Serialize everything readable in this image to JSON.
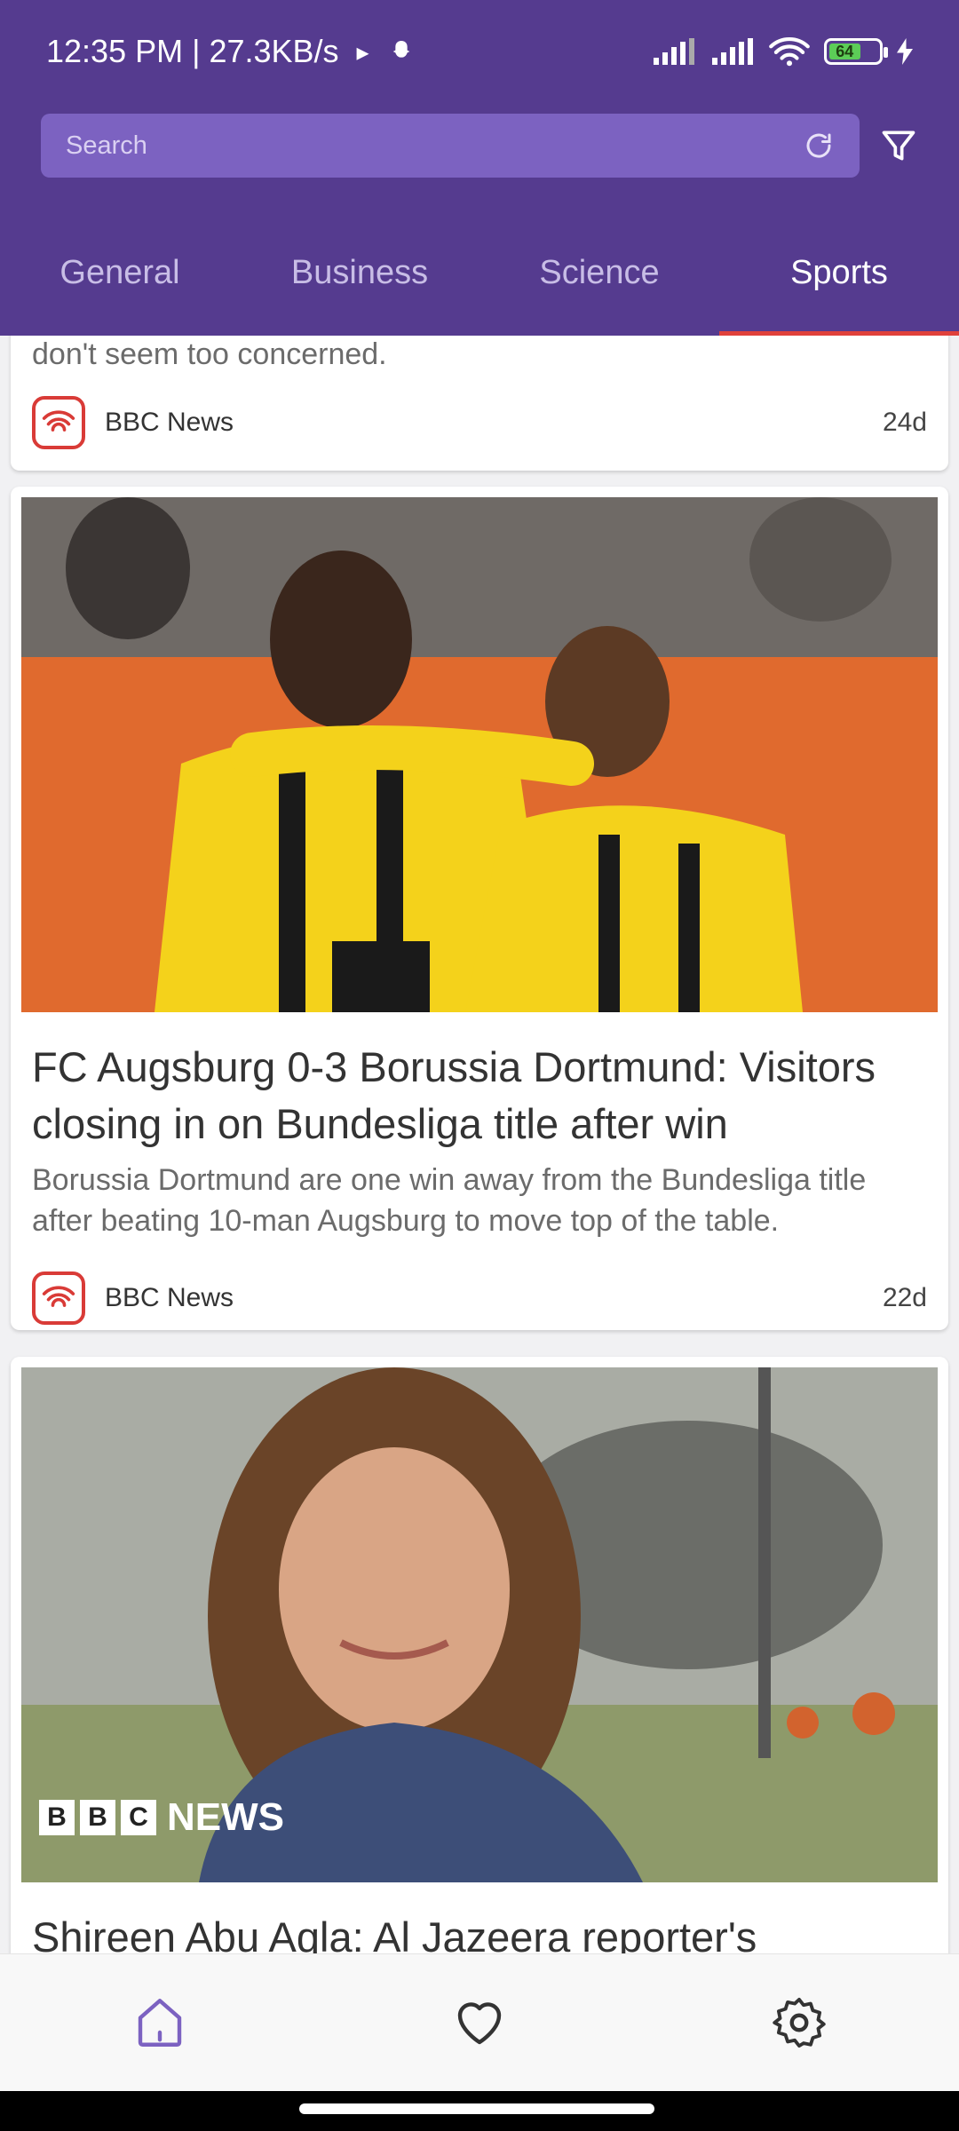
{
  "status_bar": {
    "time_speed": "12:35 PM | 27.3KB/s",
    "battery": "64"
  },
  "search": {
    "placeholder": "Search"
  },
  "tabs": [
    {
      "label": "General",
      "active": false
    },
    {
      "label": "Business",
      "active": false
    },
    {
      "label": "Science",
      "active": false
    },
    {
      "label": "Sports",
      "active": true
    }
  ],
  "articles": [
    {
      "description": "don't seem too concerned.",
      "source": "BBC News",
      "age": "24d"
    },
    {
      "title": "FC Augsburg 0-3 Borussia Dortmund: Visitors closing in on Bundesliga title after win",
      "description": "Borussia Dortmund are one win away from the Bundesliga title after beating 10-man Augsburg to move top of the table.",
      "source": "BBC News",
      "age": "22d"
    },
    {
      "title": "Shireen Abu Aqla: Al Jazeera reporter's",
      "image_overlay": {
        "letters": [
          "B",
          "B",
          "C"
        ],
        "word": "NEWS"
      }
    }
  ],
  "bottom_nav": [
    {
      "icon": "home-icon",
      "active": true
    },
    {
      "icon": "heart-icon",
      "active": false
    },
    {
      "icon": "settings-icon",
      "active": false
    }
  ],
  "colors": {
    "header": "#553b8f",
    "search_bg": "#7c62c1",
    "tab_indicator": "#e0413b",
    "source_icon": "#d93b37",
    "nav_active": "#7c62c1"
  }
}
